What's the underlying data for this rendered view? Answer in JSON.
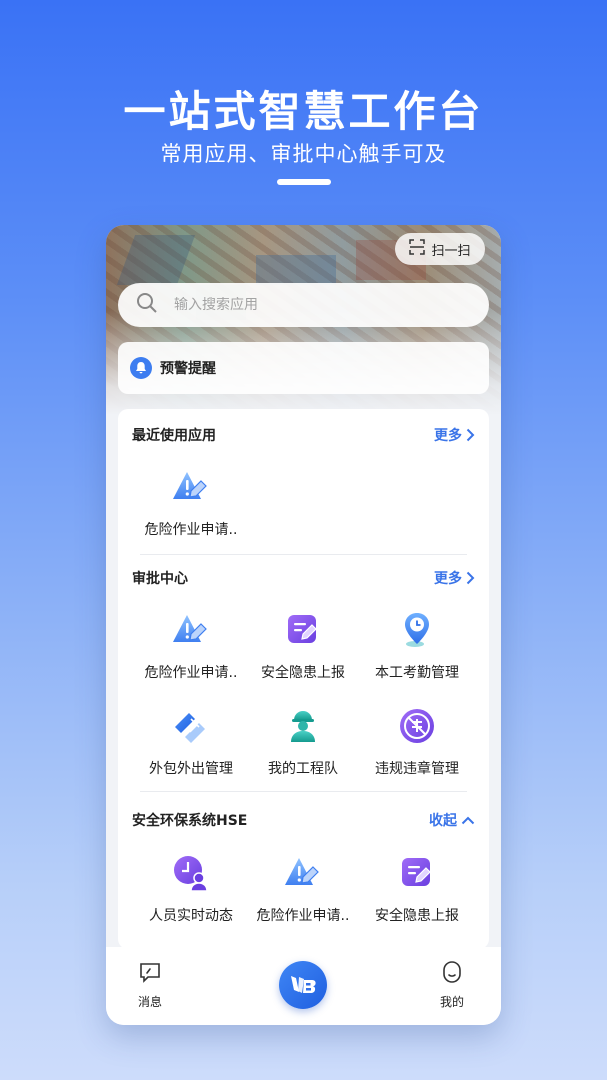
{
  "hero": {
    "title": "一站式智慧工作台",
    "subtitle": "常用应用、审批中心触手可及"
  },
  "scan": {
    "label": "扫一扫",
    "icon": "scan-icon"
  },
  "search": {
    "placeholder": "输入搜索应用",
    "icon": "search-icon"
  },
  "alert": {
    "label": "预警提醒",
    "icon": "bell-icon"
  },
  "sections": {
    "recent": {
      "title": "最近使用应用",
      "action": "更多",
      "apps": [
        {
          "label": "危险作业申请..",
          "icon": "warning-edit-icon"
        }
      ]
    },
    "approval": {
      "title": "审批中心",
      "action": "更多",
      "apps": [
        {
          "label": "危险作业申请..",
          "icon": "warning-edit-icon"
        },
        {
          "label": "安全隐患上报",
          "icon": "report-edit-icon"
        },
        {
          "label": "本工考勤管理",
          "icon": "location-clock-icon"
        },
        {
          "label": "外包外出管理",
          "icon": "handshake-icon"
        },
        {
          "label": "我的工程队",
          "icon": "worker-icon"
        },
        {
          "label": "违规违章管理",
          "icon": "violation-icon"
        }
      ]
    },
    "hse": {
      "title": "安全环保系统HSE",
      "action": "收起",
      "apps": [
        {
          "label": "人员实时动态",
          "icon": "person-clock-icon"
        },
        {
          "label": "危险作业申请..",
          "icon": "warning-edit-icon"
        },
        {
          "label": "安全隐患上报",
          "icon": "report-edit-icon"
        }
      ]
    }
  },
  "tabbar": {
    "messages": "消息",
    "mine": "我的",
    "home_icon": "app-logo-icon"
  },
  "colors": {
    "accent": "#3a74e8",
    "purple": "#7b4fe0"
  }
}
